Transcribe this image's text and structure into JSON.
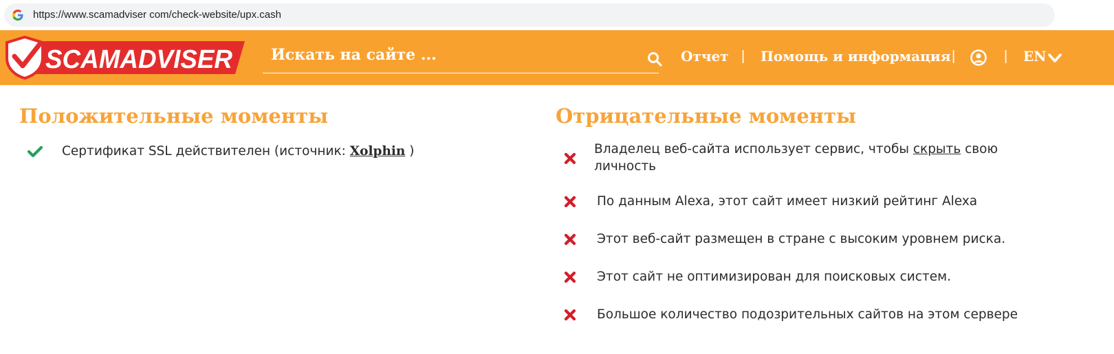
{
  "browser": {
    "url": "https://www.scamadviser com/check-website/upx.cash"
  },
  "header": {
    "logo_text": "SCAMADVISER",
    "search_placeholder": "Искать на сайте ...",
    "nav": {
      "report": "Отчет",
      "help": "Помощь и информация",
      "lang": "EN",
      "separator": "|"
    }
  },
  "positives": {
    "title": "Положительные моменты",
    "items": [
      {
        "before": "Сертификат SSL действителен (источник: ",
        "link": "Xolphin",
        "after": " )"
      }
    ]
  },
  "negatives": {
    "title": "Отрицательные моменты",
    "items": [
      {
        "line1_before": "Владелец веб-сайта использует сервис, чтобы ",
        "link": "скрыть",
        "line1_after": " свою",
        "line2": "личность"
      },
      {
        "text": "По данным Alexa, этот сайт имеет низкий рейтинг Alexa"
      },
      {
        "text": "Этот веб-сайт размещен в стране с высоким уровнем риска."
      },
      {
        "text": "Этот сайт не оптимизирован для поисковых систем."
      },
      {
        "text": "Большое количество подозрительных сайтов на этом сервере"
      }
    ]
  },
  "colors": {
    "brand_orange": "#f9a12f",
    "heading_orange": "#f7a43a",
    "logo_red": "#e52c2c",
    "check_green": "#21a35a",
    "cross_red": "#d21e2a"
  }
}
